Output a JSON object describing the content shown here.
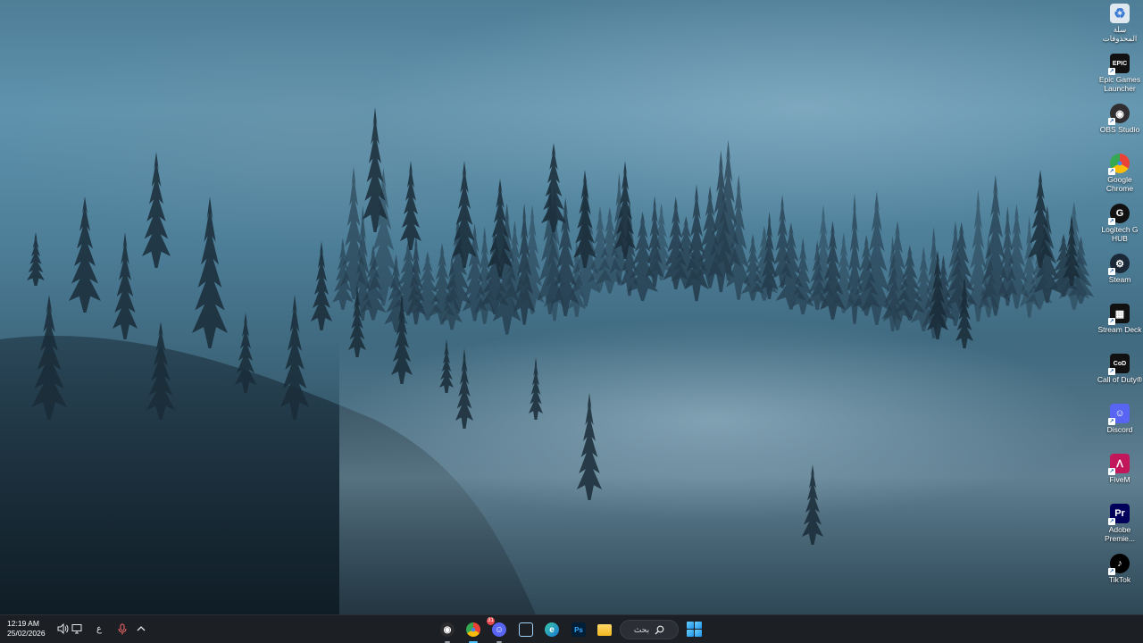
{
  "desktop": {
    "icons": [
      {
        "label": "سلة المحذوفات",
        "icon": "recycle-bin-icon",
        "color": "#dfe8ef"
      },
      {
        "label": "Epic Games Launcher",
        "icon": "epic-games-icon",
        "color": "#111111"
      },
      {
        "label": "OBS Studio",
        "icon": "obs-studio-icon",
        "color": "#302e31"
      },
      {
        "label": "Google Chrome",
        "icon": "chrome-icon",
        "color": "#4285f4"
      },
      {
        "label": "Logitech G HUB",
        "icon": "logitech-g-icon",
        "color": "#111111"
      },
      {
        "label": "Steam",
        "icon": "steam-icon",
        "color": "#1b2838"
      },
      {
        "label": "Stream Deck",
        "icon": "stream-deck-icon",
        "color": "#111111"
      },
      {
        "label": "Call of Duty®",
        "icon": "call-of-duty-icon",
        "color": "#111111"
      },
      {
        "label": "Discord",
        "icon": "discord-icon",
        "color": "#5865f2"
      },
      {
        "label": "FiveM",
        "icon": "fivem-icon",
        "color": "#c2185b"
      },
      {
        "label": "Adobe Premie...",
        "icon": "premiere-pro-icon",
        "color": "#00005b"
      },
      {
        "label": "TikTok",
        "icon": "tiktok-icon",
        "color": "#000000"
      }
    ]
  },
  "taskbar": {
    "clock": {
      "time": "12:19 AM",
      "date": "25/02/2026"
    },
    "tray": {
      "language": "ع",
      "volume_icon": "volume-icon",
      "display_icon": "display-icon",
      "mic_icon": "microphone-icon",
      "overflow_icon": "chevron-up-icon"
    },
    "apps": [
      {
        "name": "obs-studio",
        "icon": "obs-studio-icon",
        "badge": "",
        "active": false,
        "running": true
      },
      {
        "name": "chrome",
        "icon": "chrome-icon",
        "badge": "",
        "active": true,
        "running": true
      },
      {
        "name": "discord",
        "icon": "discord-icon",
        "badge": "31",
        "active": false,
        "running": true
      },
      {
        "name": "task-view",
        "icon": "task-view-icon",
        "badge": "",
        "active": false,
        "running": false
      },
      {
        "name": "edge",
        "icon": "edge-icon",
        "badge": "",
        "active": false,
        "running": false
      },
      {
        "name": "photoshop",
        "icon": "photoshop-icon",
        "badge": "",
        "active": false,
        "running": false
      },
      {
        "name": "file-explorer",
        "icon": "folder-icon",
        "badge": "",
        "active": false,
        "running": false
      }
    ],
    "search": {
      "label": "بحث",
      "icon": "search-icon"
    },
    "start_icon": "windows-start-icon",
    "accent": "#4cc2ff"
  }
}
